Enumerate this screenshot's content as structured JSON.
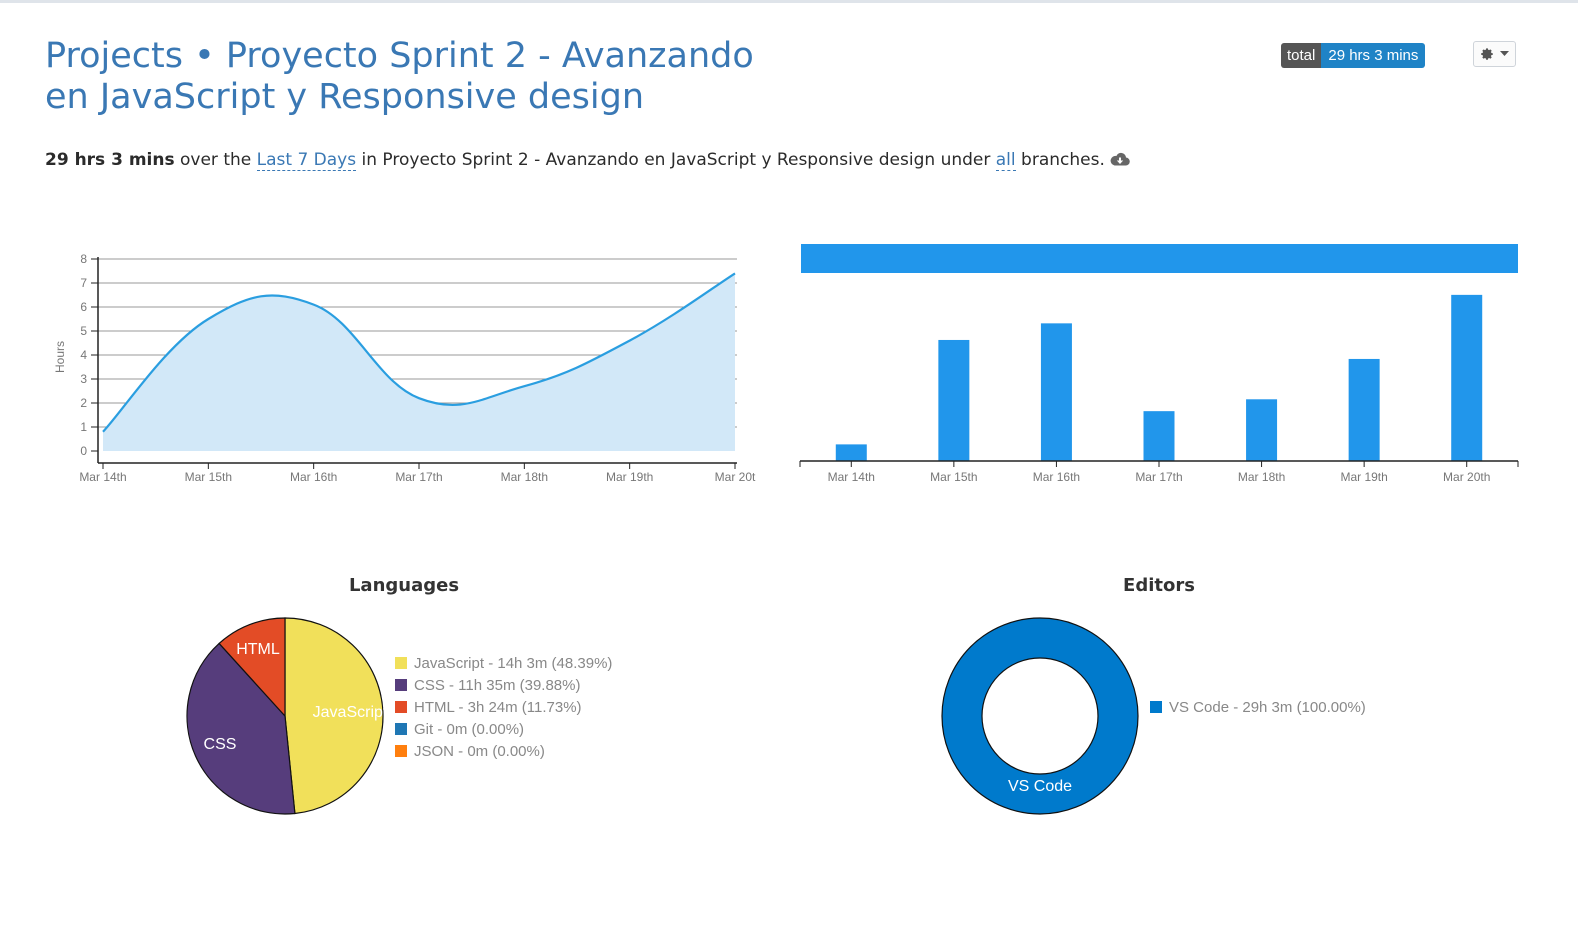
{
  "header": {
    "projects_link": "Projects",
    "separator": "•",
    "project_name": "Proyecto Sprint 2 - Avanzando en JavaScript y Responsive design"
  },
  "total_badge": {
    "label": "total",
    "value": "29 hrs 3 mins"
  },
  "settings": {
    "icon": "gear-icon",
    "caret_icon": "caret-down-icon"
  },
  "summary": {
    "total": "29 hrs 3 mins",
    "over_the": "over the",
    "range_link": "Last 7 Days",
    "in_text": "in Proyecto Sprint 2 - Avanzando en JavaScript y Responsive design under",
    "branches_link": "all",
    "branches_text": "branches.",
    "icon": "cloud-download-icon"
  },
  "chart_data": [
    {
      "type": "area",
      "ylabel": "Hours",
      "categories": [
        "Mar 14th",
        "Mar 15th",
        "Mar 16th",
        "Mar 17th",
        "Mar 18th",
        "Mar 19th",
        "Mar 20t"
      ],
      "values": [
        0.8,
        5.5,
        6.1,
        2.2,
        2.7,
        4.6,
        7.4
      ],
      "ylim": [
        0,
        8
      ],
      "yticks": [
        0,
        1,
        2,
        3,
        4,
        5,
        6,
        7,
        8
      ],
      "grid": true,
      "line_color": "#2a9ee0",
      "fill_color": "#d2e8f8"
    },
    {
      "type": "bar",
      "categories": [
        "Mar 14th",
        "Mar 15th",
        "Mar 16th",
        "Mar 17th",
        "Mar 18th",
        "Mar 19th",
        "Mar 20th"
      ],
      "values": [
        0.7,
        5.1,
        5.8,
        2.1,
        2.6,
        4.3,
        7.0
      ],
      "ylim": [
        0,
        7.5
      ],
      "color": "#2196eb",
      "header_bar_color": "#2196eb"
    },
    {
      "type": "pie",
      "title": "Languages",
      "slices": [
        {
          "name": "JavaScript",
          "legend": "JavaScript - 14h 3m (48.39%)",
          "value": 48.39,
          "color": "#f1e05a",
          "label": "JavaScript"
        },
        {
          "name": "CSS",
          "legend": "CSS - 11h 35m (39.88%)",
          "value": 39.88,
          "color": "#563d7c",
          "label": "CSS"
        },
        {
          "name": "HTML",
          "legend": "HTML - 3h 24m (11.73%)",
          "value": 11.73,
          "color": "#e34c26",
          "label": "HTML"
        },
        {
          "name": "Git",
          "legend": "Git - 0m (0.00%)",
          "value": 0,
          "color": "#1f77b4",
          "label": ""
        },
        {
          "name": "JSON",
          "legend": "JSON - 0m (0.00%)",
          "value": 0,
          "color": "#ff7f0e",
          "label": ""
        }
      ]
    },
    {
      "type": "pie",
      "title": "Editors",
      "donut": true,
      "slices": [
        {
          "name": "VS Code",
          "legend": "VS Code - 29h 3m (100.00%)",
          "value": 100,
          "color": "#007acc",
          "label": "VS Code"
        }
      ]
    }
  ]
}
